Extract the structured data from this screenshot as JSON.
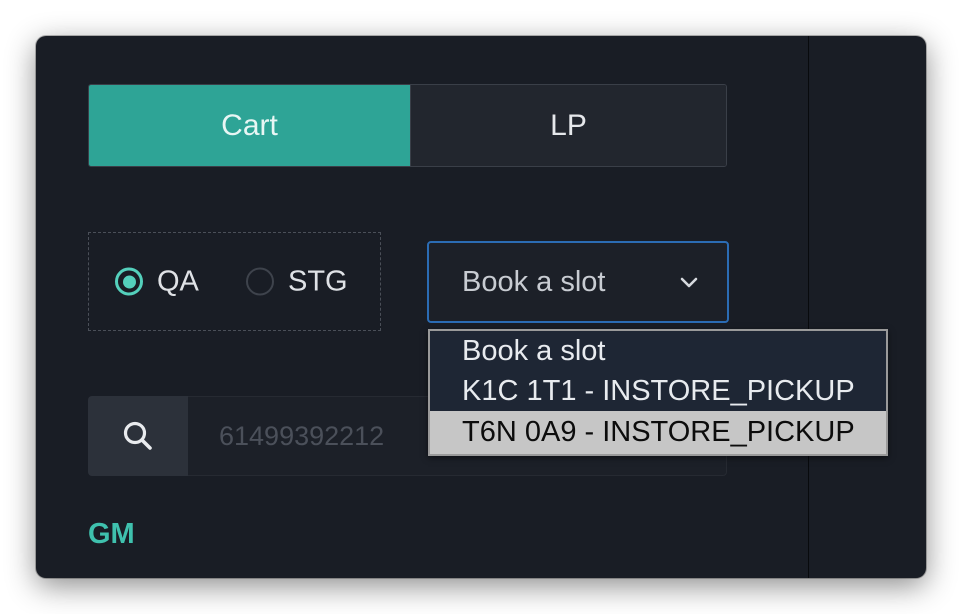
{
  "tabs": {
    "active_label": "Cart",
    "inactive_label": "LP"
  },
  "environment": {
    "options": [
      {
        "label": "QA",
        "selected": true
      },
      {
        "label": "STG",
        "selected": false
      }
    ]
  },
  "slot_select": {
    "value": "Book a slot",
    "icon": "chevron-down-icon",
    "options": [
      "Book a slot",
      "K1C 1T1 - INSTORE_PICKUP",
      "T6N 0A9 - INSTORE_PICKUP"
    ],
    "highlighted_option": "T6N 0A9 - INSTORE_PICKUP"
  },
  "search": {
    "icon": "search-icon",
    "placeholder": "61499392212"
  },
  "section": {
    "label": "GM"
  },
  "colors": {
    "background": "#191d25",
    "accent": "#2ea496",
    "radio_accent": "#54d0bc",
    "focus_border": "#2b6cb4",
    "section_label": "#3fc1ae"
  }
}
